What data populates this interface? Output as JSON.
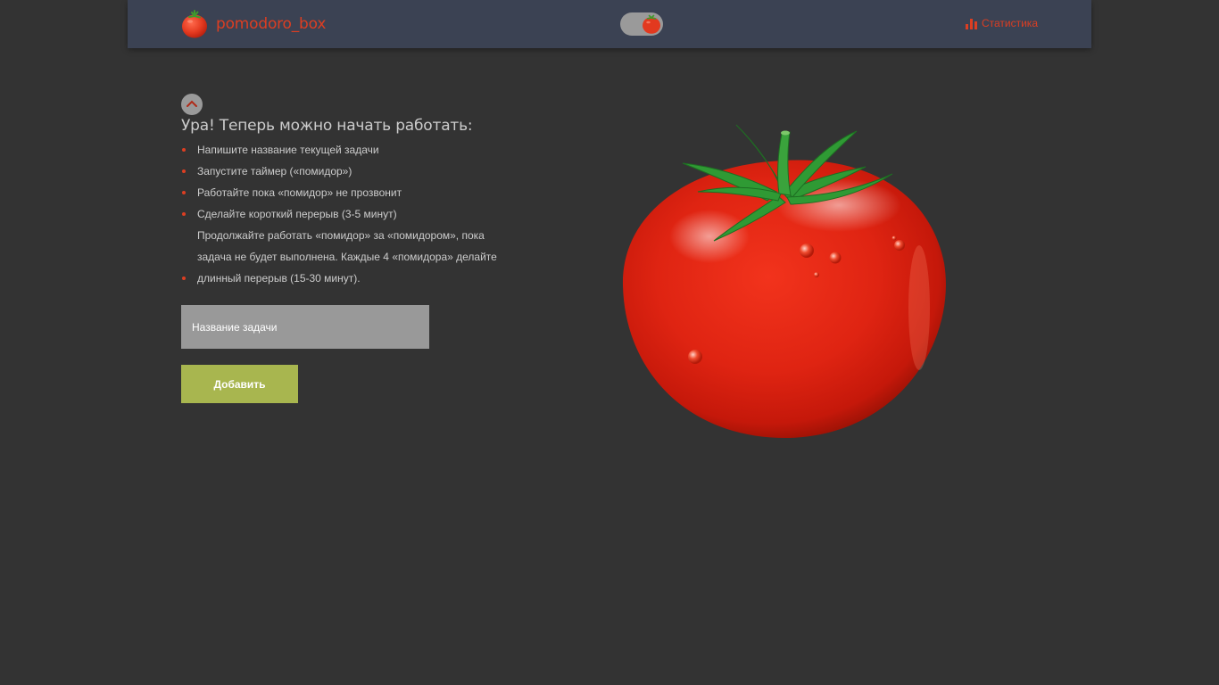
{
  "header": {
    "app_name": "pomodoro_box",
    "logo_icon": "tomato-icon",
    "theme_toggle_icon": "tomato-icon",
    "stats_icon": "bar-chart-icon",
    "stats_label": "Статистика"
  },
  "intro": {
    "collapse_icon": "chevron-up-icon",
    "title": "Ура! Теперь можно начать работать:",
    "steps": [
      "Напишите название текущей задачи",
      "Запустите таймер («помидор»)",
      "Работайте пока «помидор» не прозвонит",
      "Сделайте короткий перерыв (3-5 минут)",
      "Продолжайте работать «помидор» за «помидором», пока задача не будет выполнена. Каждые 4 «помидора» делайте длинный перерыв (15-30 минут)."
    ]
  },
  "form": {
    "task_placeholder": "Название задачи",
    "add_label": "Добавить"
  },
  "illustration": {
    "icon": "tomato-illustration"
  },
  "colors": {
    "background": "#333333",
    "header_background": "#3b4253",
    "accent_red": "#dc3e22",
    "text": "#cccccc",
    "input_background": "#999999",
    "button_green": "#a8b64f"
  }
}
